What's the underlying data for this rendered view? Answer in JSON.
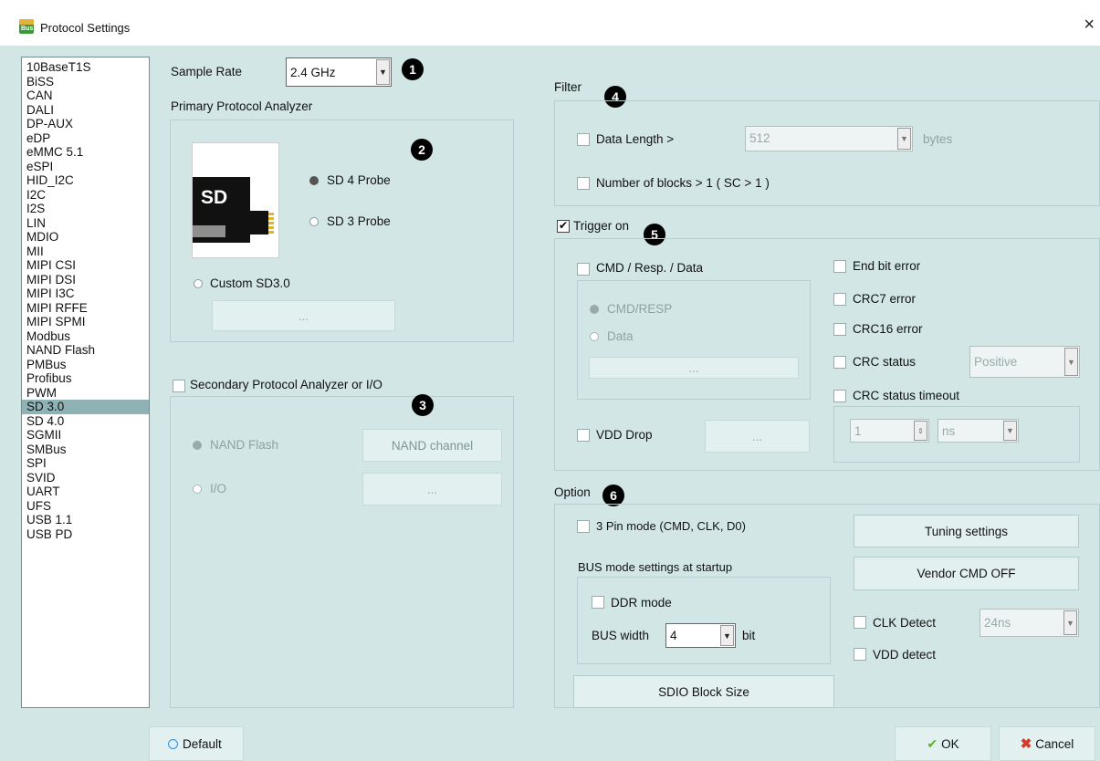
{
  "window": {
    "title": "Protocol Settings",
    "close": "×",
    "icon_name": "bus-app-icon"
  },
  "protocols": {
    "selected": "SD 3.0",
    "items": [
      "10BaseT1S",
      "BiSS",
      "CAN",
      "DALI",
      "DP-AUX",
      "eDP",
      "eMMC 5.1",
      "eSPI",
      "HID_I2C",
      "I2C",
      "I2S",
      "LIN",
      "MDIO",
      "MII",
      "MIPI CSI",
      "MIPI DSI",
      "MIPI I3C",
      "MIPI RFFE",
      "MIPI SPMI",
      "Modbus",
      "NAND Flash",
      "PMBus",
      "Profibus",
      "PWM",
      "SD 3.0",
      "SD 4.0",
      "SGMII",
      "SMBus",
      "SPI",
      "SVID",
      "UART",
      "UFS",
      "USB 1.1",
      "USB PD"
    ]
  },
  "sample_rate": {
    "label": "Sample Rate",
    "value": "2.4 GHz"
  },
  "badges": {
    "b1": "1",
    "b2": "2",
    "b3": "3",
    "b4": "4",
    "b5": "5",
    "b6": "6"
  },
  "primary": {
    "title": "Primary Protocol Analyzer",
    "sd_text": "SD",
    "sd4": "SD 4 Probe",
    "sd3": "SD 3 Probe",
    "custom": "Custom SD3.0",
    "custom_btn": "...",
    "selected": "SD 4 Probe"
  },
  "secondary": {
    "checkbox_label": "Secondary Protocol Analyzer or I/O",
    "checked": false,
    "nand": "NAND Flash",
    "nand_channel": "NAND channel",
    "io": "I/O",
    "io_btn": "..."
  },
  "filter": {
    "title": "Filter",
    "data_length": "Data Length >",
    "data_length_value": "512",
    "bytes": "bytes",
    "blocks": "Number of blocks > 1 ( SC > 1 )"
  },
  "trigger": {
    "title": "Trigger on",
    "checked": true,
    "cmd": "CMD / Resp. / Data",
    "cmd_resp": "CMD/RESP",
    "data": "Data",
    "cmd_btn": "...",
    "vdd_drop": "VDD Drop",
    "vdd_btn": "...",
    "end_bit": "End bit error",
    "crc7": "CRC7 error",
    "crc16": "CRC16 error",
    "crc_status": "CRC status",
    "crc_status_value": "Positive",
    "crc_timeout": "CRC status timeout",
    "timeout_value": "1",
    "timeout_unit": "ns"
  },
  "option": {
    "title": "Option",
    "pin3": "3 Pin mode (CMD, CLK, D0)",
    "bus_startup": "BUS mode settings at startup",
    "ddr": "DDR mode",
    "bus_width_label": "BUS width",
    "bus_width_value": "4",
    "bit": "bit",
    "sdio": "SDIO Block Size",
    "tuning": "Tuning settings",
    "vendor": "Vendor CMD OFF",
    "clk_detect": "CLK Detect",
    "clk_value": "24ns",
    "vdd_detect": "VDD detect"
  },
  "footer": {
    "default": "Default",
    "ok": "OK",
    "cancel": "Cancel"
  },
  "colors": {
    "background": "#d2e6e6",
    "selection": "#8fb3b5",
    "ok_check": "#5fae2f",
    "cancel_x": "#d23a2a"
  }
}
